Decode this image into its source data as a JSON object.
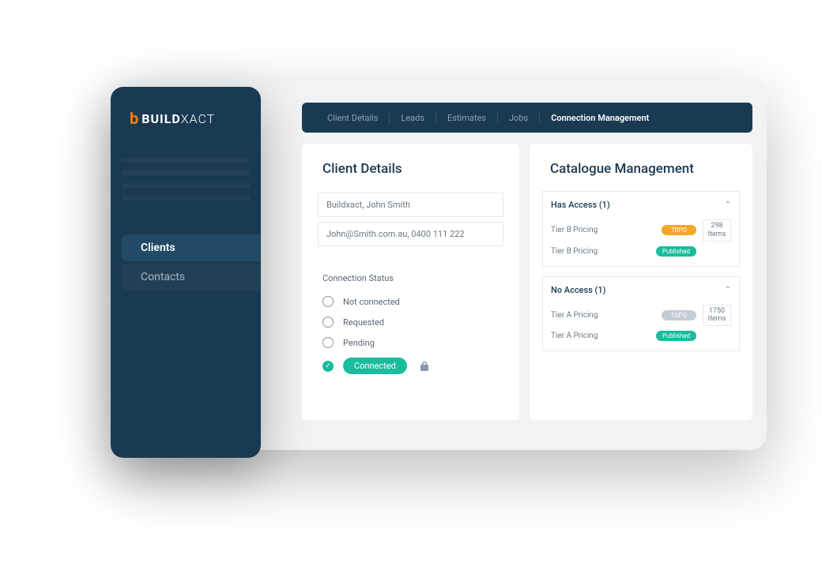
{
  "brand": {
    "icon": "b",
    "text_prefix": "BUILD",
    "text_suffix": "XACT"
  },
  "sidebar": {
    "items": [
      {
        "label": "Clients",
        "active": true
      },
      {
        "label": "Contacts",
        "active": false
      }
    ]
  },
  "tabs": [
    {
      "label": "Client Details"
    },
    {
      "label": "Leads"
    },
    {
      "label": "Estimates"
    },
    {
      "label": "Jobs"
    },
    {
      "label": "Connection Management",
      "active": true
    }
  ],
  "client_panel": {
    "title": "Client Details",
    "fields": [
      "Buildxact, John Smith",
      "John@Smith.com.au, 0400 111 222"
    ],
    "status_label": "Connection Status",
    "statuses": [
      {
        "label": "Not connected",
        "selected": false
      },
      {
        "label": "Requested",
        "selected": false
      },
      {
        "label": "Pending",
        "selected": false
      },
      {
        "label": "Connected",
        "selected": true
      }
    ]
  },
  "catalogue_panel": {
    "title": "Catalogue Management",
    "sections": [
      {
        "header": "Has Access (1)",
        "rows": [
          {
            "name": "Tier B Pricing",
            "badge": "TBPO",
            "badge_color": "orange"
          },
          {
            "name": "Tier B Pricing",
            "badge": "Published",
            "badge_color": "teal"
          }
        ],
        "count": "298",
        "count_label": "Items"
      },
      {
        "header": "No Access (1)",
        "rows": [
          {
            "name": "Tier A Pricing",
            "badge": "TAPO",
            "badge_color": "grey"
          },
          {
            "name": "Tier A Pricing",
            "badge": "Published",
            "badge_color": "teal"
          }
        ],
        "count": "1750",
        "count_label": "Items"
      }
    ]
  }
}
